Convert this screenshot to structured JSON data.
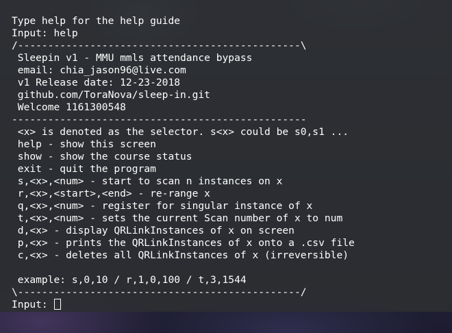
{
  "terminal": {
    "lines": [
      "Type help for the help guide",
      "Input: help",
      "/-----------------------------------------------\\",
      " Sleepin v1 - MMU mmls attendance bypass",
      " email: chia_jason96@live.com",
      " v1 Release date: 12-23-2018",
      " github.com/ToraNova/sleep-in.git",
      " Welcome 1161300548",
      "-------------------------------------------------",
      " <x> is denoted as the selector. s<x> could be s0,s1 ...",
      " help - show this screen",
      " show - show the course status",
      " exit - quit the program",
      " s,<x>,<num> - start to scan n instances on x",
      " r,<x>,<start>,<end> - re-range x",
      " q,<x>,<num> - register for singular instance of x",
      " t,<x>,<num> - sets the current Scan number of x to num",
      " d,<x> - display QRLinkInstances of x on screen",
      " p,<x> - prints the QRLinkInstances of x onto a .csv file",
      " c,<x> - deletes all QRLinkInstances of x (irreversible)",
      "",
      " example: s,0,10 / r,1,0,100 / t,3,1544",
      "\\-----------------------------------------------/"
    ],
    "prompt": "Input: "
  }
}
